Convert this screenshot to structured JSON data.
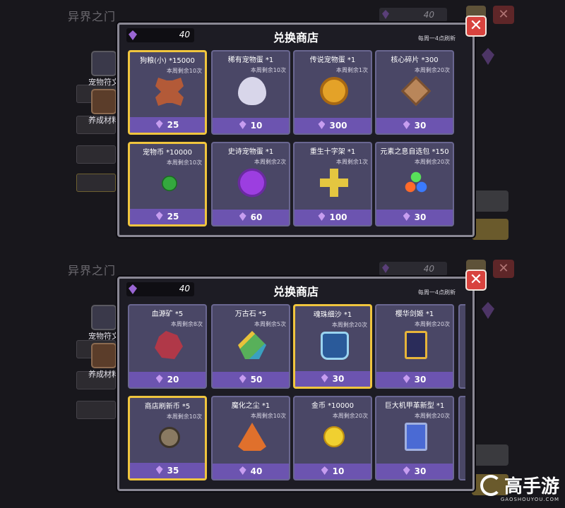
{
  "panels": [
    {
      "background": {
        "title": "异界之门",
        "res_value": "40",
        "close_glyph": "✕",
        "tabs": [
          "宠物符文",
          "养成材料"
        ]
      },
      "shop": {
        "title": "兑换商店",
        "refresh_note": "每周一4点刷新",
        "currency_value": "40",
        "close_glyph": "✕",
        "items": [
          {
            "name": "狗粮(小) *15000",
            "left": "本周剩余10次",
            "price": "25",
            "icon": "bone-icon",
            "art": "a-bone",
            "selected": true
          },
          {
            "name": "稀有宠物蛋 *1",
            "left": "本周剩余10次",
            "price": "10",
            "icon": "white-egg-icon",
            "art": "a-egg-w",
            "selected": false
          },
          {
            "name": "传说宠物蛋 *1",
            "left": "本周剩余1次",
            "price": "300",
            "icon": "gold-egg-icon",
            "art": "a-egg-g",
            "selected": false
          },
          {
            "name": "核心碎片 *300",
            "left": "本周剩余20次",
            "price": "30",
            "icon": "core-fragment-icon",
            "art": "a-core",
            "selected": false
          },
          {
            "name": "宠物币 *10000",
            "left": "本周剩余10次",
            "price": "25",
            "icon": "pet-coin-icon",
            "art": "a-coin-g",
            "selected": true
          },
          {
            "name": "史诗宠物蛋 *1",
            "left": "本周剩余2次",
            "price": "60",
            "icon": "purple-egg-icon",
            "art": "a-egg-p",
            "selected": false
          },
          {
            "name": "重生十字架 *1",
            "left": "本周剩余1次",
            "price": "100",
            "icon": "cross-icon",
            "art": "a-cross",
            "selected": false
          },
          {
            "name": "元素之息自选包 *150",
            "left": "本周剩余20次",
            "price": "30",
            "icon": "element-orbs-icon",
            "art": "a-elem",
            "selected": false
          }
        ]
      }
    },
    {
      "background": {
        "title": "异界之门",
        "res_value": "40",
        "close_glyph": "✕",
        "tabs": [
          "宠物符文",
          "养成材料"
        ]
      },
      "shop": {
        "title": "兑换商店",
        "refresh_note": "每周一4点刷新",
        "currency_value": "40",
        "close_glyph": "✕",
        "items": [
          {
            "name": "血源矿 *5",
            "left": "本周剩余8次",
            "price": "20",
            "icon": "blood-ore-icon",
            "art": "a-blood",
            "selected": false
          },
          {
            "name": "万古石 *5",
            "left": "本周剩余5次",
            "price": "50",
            "icon": "ancient-stone-icon",
            "art": "a-stone",
            "selected": false
          },
          {
            "name": "魂珠细沙 *1",
            "left": "本周剩余20次",
            "price": "30",
            "icon": "sand-jar-icon",
            "art": "a-jar",
            "selected": true
          },
          {
            "name": "樱华剑姬 *1",
            "left": "本周剩余20次",
            "price": "30",
            "icon": "hero-card-icon",
            "art": "a-cardart",
            "selected": false
          },
          {
            "name": "商店刷新币 *5",
            "left": "本周剩余10次",
            "price": "35",
            "icon": "refresh-coin-icon",
            "art": "a-refresh",
            "selected": true
          },
          {
            "name": "魔化之尘 *1",
            "left": "本周剩余10次",
            "price": "40",
            "icon": "magic-dust-icon",
            "art": "a-magic",
            "selected": false
          },
          {
            "name": "金币 *10000",
            "left": "本周剩余20次",
            "price": "10",
            "icon": "gold-coin-icon",
            "art": "a-gold",
            "selected": false
          },
          {
            "name": "巨大机甲革新型 *1",
            "left": "本周剩余20次",
            "price": "30",
            "icon": "mech-card-icon",
            "art": "a-mech",
            "selected": false
          }
        ]
      }
    }
  ],
  "watermark": {
    "main": "高手游",
    "sub": "GAOSHOUYOU.COM"
  }
}
